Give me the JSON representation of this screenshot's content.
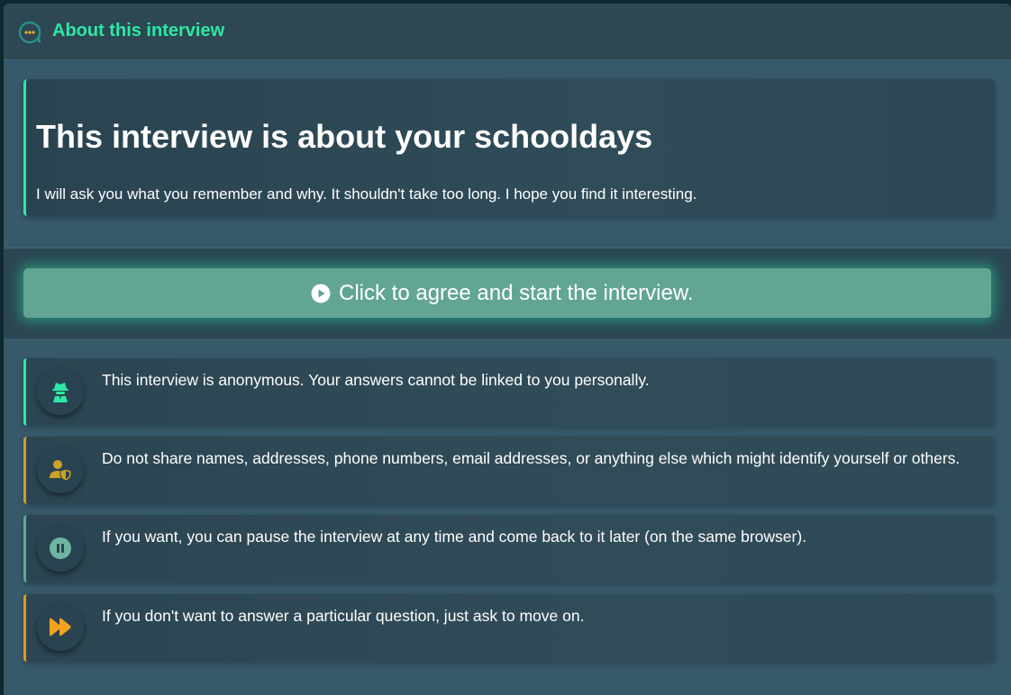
{
  "header": {
    "title": "About this interview",
    "logo_icon": "chat-bubble-icon",
    "title_color": "#2de8a4"
  },
  "intro": {
    "heading": "This interview is about your schooldays",
    "description": "I will ask you what you remember and why. It shouldn't take too long. I hope you find it interesting."
  },
  "start_button": {
    "label": "Click to agree and start the interview.",
    "icon": "play-circle-icon",
    "color": "#62a594"
  },
  "info_items": [
    {
      "icon": "incognito-icon",
      "accent": "#2de8a4",
      "text": "This interview is anonymous. Your answers cannot be linked to you personally."
    },
    {
      "icon": "user-shield-icon",
      "accent": "#c9a227",
      "text": "Do not share names, addresses, phone numbers, email addresses, or anything else which might identify yourself or others."
    },
    {
      "icon": "pause-circle-icon",
      "accent": "#5fa892",
      "text": "If you want, you can pause the interview at any time and come back to it later (on the same browser)."
    },
    {
      "icon": "fast-forward-icon",
      "accent": "#e6961e",
      "text": "If you don't want to answer a particular question, just ask to move on."
    }
  ]
}
